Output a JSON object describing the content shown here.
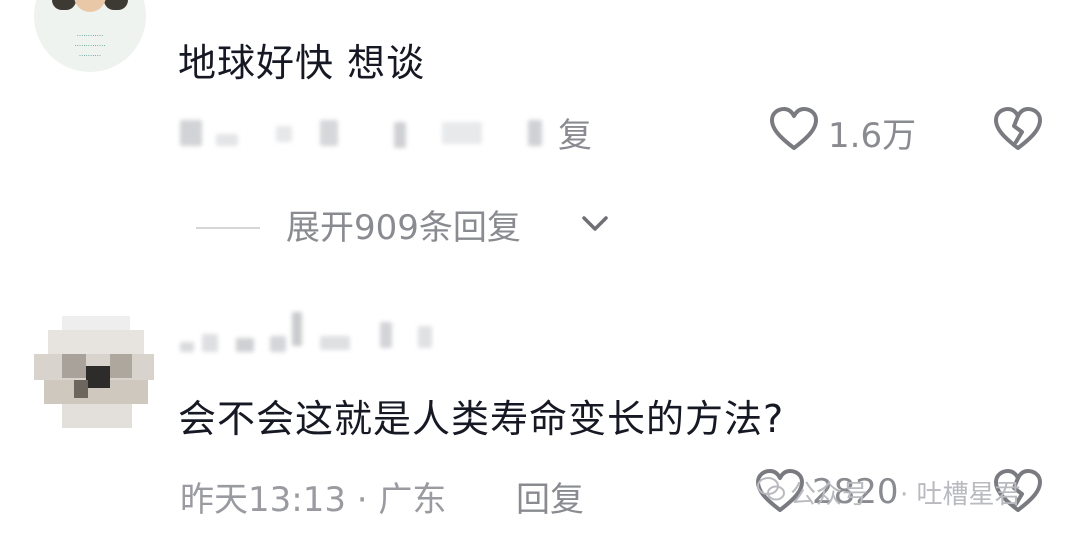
{
  "comments": [
    {
      "text": "地球好快 想谈",
      "reply_label": "复",
      "like_count": "1.6万"
    },
    {
      "text": "会不会这就是人类寿命变长的方法?",
      "time_location": "昨天13:13 · 广东",
      "reply_label": "回复",
      "like_count": "2820"
    }
  ],
  "expand_replies": "展开909条回复",
  "watermark": {
    "text_a": "公众号",
    "text_b": "· 吐槽星君"
  },
  "icons": {
    "like": "heart-outline-icon",
    "dislike": "broken-heart-icon",
    "expand": "chevron-down-icon",
    "wechat": "wechat-icon"
  },
  "colors": {
    "primary_text": "#161823",
    "secondary_text": "#8a8b90",
    "meta_text": "#9a9ba1",
    "icon": "#7a7b80"
  }
}
